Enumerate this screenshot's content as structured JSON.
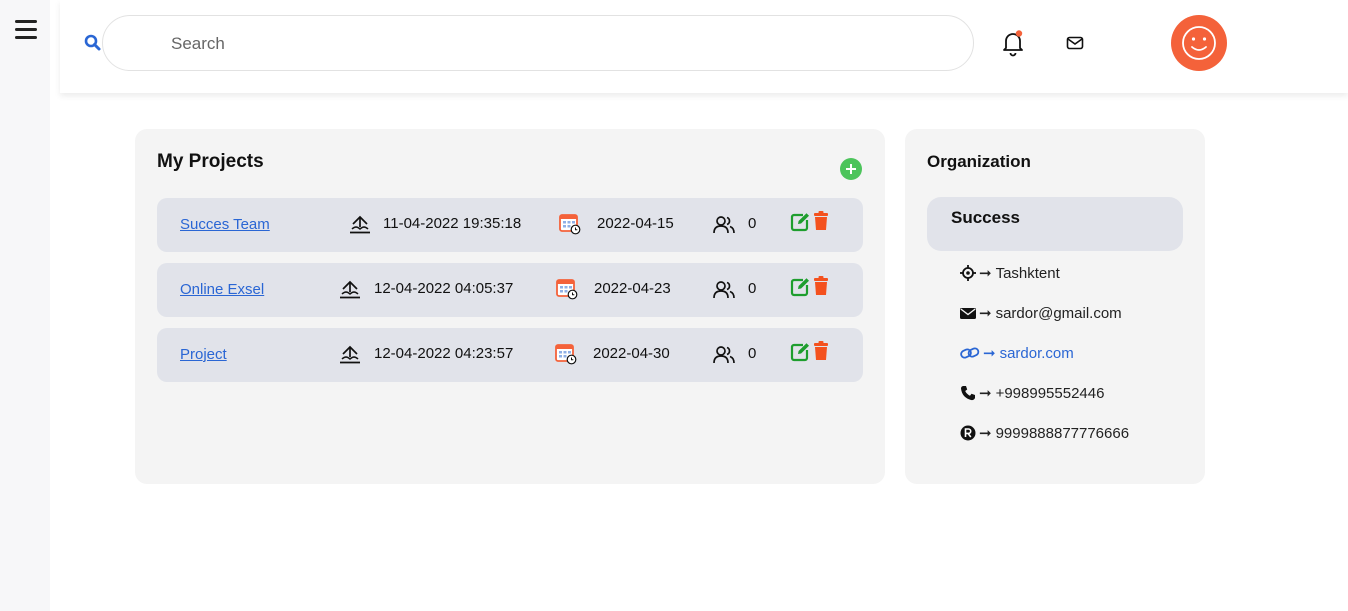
{
  "header": {
    "search_placeholder": "Search",
    "icons": [
      "menu-icon",
      "search-icon",
      "bell-icon",
      "mail-icon",
      "smiley-avatar-icon"
    ],
    "colors": {
      "accent_blue": "#2a66d4",
      "avatar": "#f4623a",
      "notification_dot": "#f4623a"
    }
  },
  "projects": {
    "title": "My Projects",
    "rows": [
      {
        "name": "Succes Team",
        "created": "11-04-2022 19:35:18",
        "deadline": "2022-04-15",
        "members": "0"
      },
      {
        "name": "Online Exsel",
        "created": "12-04-2022 04:05:37",
        "deadline": "2022-04-23",
        "members": "0"
      },
      {
        "name": "Project",
        "created": "12-04-2022 04:23:57",
        "deadline": "2022-04-30",
        "members": "0"
      }
    ],
    "colors": {
      "edit": "#1e9e2e",
      "delete": "#f4511e",
      "add": "#4cc45b"
    }
  },
  "organization": {
    "title": "Organization",
    "name": "Success",
    "location": "Tashktent",
    "email": "sardor@gmail.com",
    "website": "sardor.com",
    "phone": "+998995552446",
    "registration": "9999888877776666",
    "arrow": "➞"
  }
}
